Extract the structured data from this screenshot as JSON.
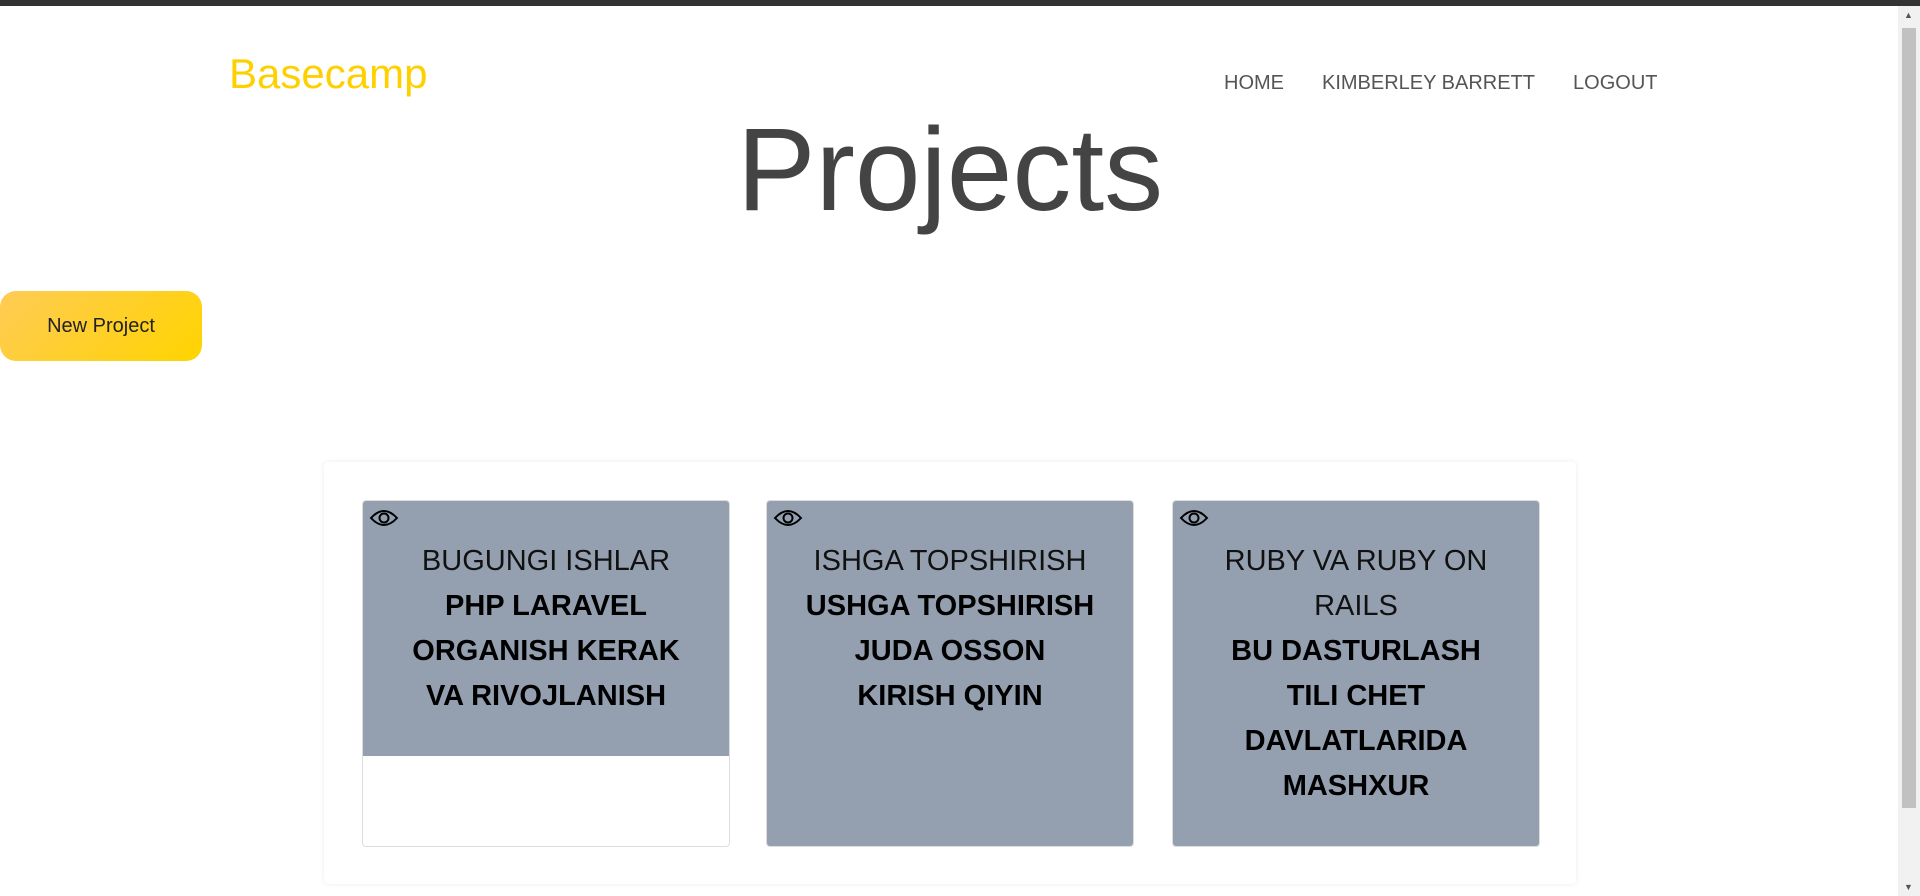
{
  "header": {
    "logo": "Basecamp",
    "nav": [
      "HOME",
      "KIMBERLEY BARRETT",
      "LOGOUT"
    ]
  },
  "page_title": "Projects",
  "new_project_label": "New Project",
  "projects": [
    {
      "title": "BUGUNGI ISHLAR",
      "description": "PHP LARAVEL ORGANISH KERAK VA RIVOJLANISH",
      "icon": "eye-icon"
    },
    {
      "title": "ISHGA TOPSHIRISH",
      "description": "USHGA TOPSHIRISH JUDA OSSON KIRISH QIYIN",
      "icon": "eye-icon"
    },
    {
      "title": "RUBY VA RUBY ON RAILS",
      "description": "BU DASTURLASH TILI CHET DAVLATLARIDA MASHXUR",
      "icon": "eye-icon"
    }
  ],
  "colors": {
    "brand": "#ffd000",
    "card": "#94a0b0",
    "button": "#ffd400"
  }
}
